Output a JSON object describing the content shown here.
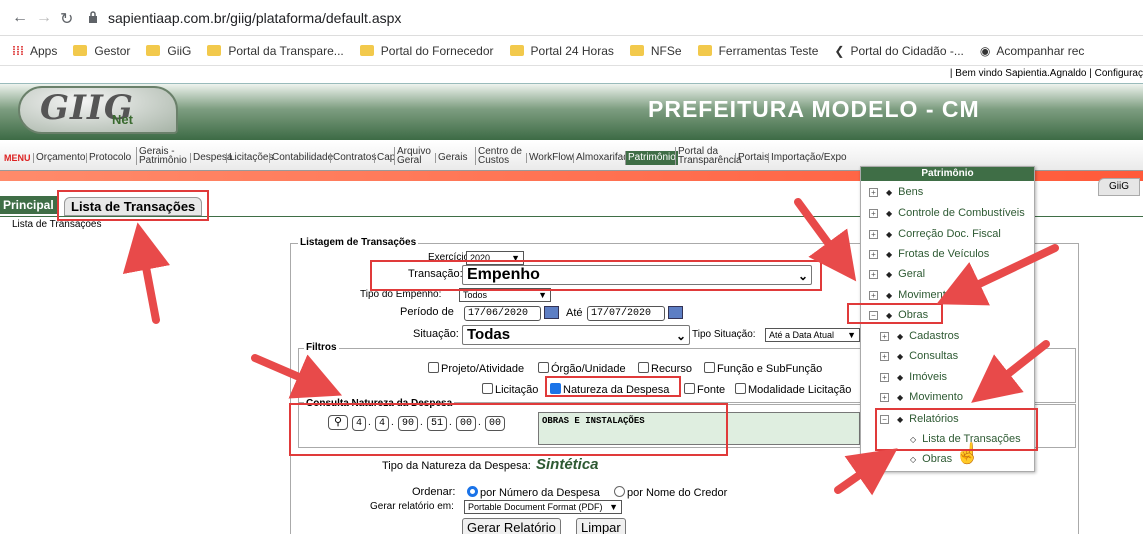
{
  "browser": {
    "url": "sapientiaap.com.br/giig/plataforma/default.aspx",
    "bookmarks": [
      "Apps",
      "Gestor",
      "GiiG",
      "Portal da Transpare...",
      "Portal do Fornecedor",
      "Portal 24 Horas",
      "NFSe",
      "Ferramentas Teste",
      "Portal do Cidadão -...",
      "Acompanhar rec"
    ]
  },
  "header": {
    "welcome": "| Bem vindo Sapientia.Agnaldo | Configuraç",
    "logo_text": "GIIG",
    "logo_net": "Net",
    "title": "PREFEITURA MODELO - CM"
  },
  "menu": {
    "label": "MENU",
    "items": [
      "Orçamento",
      "Protocolo",
      "Gerais -",
      "Patrimônio",
      "Despesa",
      "Licitações",
      "Contabilidade",
      "Contratos",
      "Cap",
      "Arquivo",
      "Geral",
      "Gerais",
      "Centro de",
      "Custos",
      "WorkFlow",
      "Almoxarifado",
      "Patrimônio",
      "Portal da",
      "Transparência",
      "Portais",
      "Importação/Expo"
    ]
  },
  "tabs": {
    "principal": "Principal",
    "lista": "Lista de Transações",
    "giig": "GiiG"
  },
  "breadcrumb": "Lista de Transações",
  "form": {
    "legend": "Listagem de Transações",
    "exercicio_label": "Exercício:",
    "exercicio": "2020",
    "transacao_label": "Transação:",
    "transacao": "Empenho",
    "tipo_empenho_label": "Tipo do Empenho:",
    "tipo_empenho": "Todos",
    "periodo_label": "Período de",
    "data_inicio": "17/06/2020",
    "ate_label": "Até",
    "data_fim": "17/07/2020",
    "situacao_label": "Situação:",
    "situacao": "Todas",
    "tipo_situacao_label": "Tipo Situação:",
    "tipo_situacao": "Até a Data Atual",
    "filtros_legend": "Filtros",
    "filtros_row1": [
      "Projeto/Atividade",
      "Órgão/Unidade",
      "Recurso",
      "Função e SubFunção"
    ],
    "filtros_row2": [
      "Licitação",
      "Natureza da Despesa",
      "Fonte",
      "Modalidade Licitação"
    ],
    "consulta_legend": "Consulta Natureza da Despesa",
    "nat_segments": [
      "4",
      "4",
      "90",
      "51",
      "00",
      "00"
    ],
    "nat_desc": "OBRAS E INSTALAÇÕES",
    "tipo_nat_label": "Tipo da Natureza da Despesa:",
    "tipo_nat": "Sintética",
    "ordenar_label": "Ordenar:",
    "ordenar_opt1": "por Número da Despesa",
    "ordenar_opt2": "por Nome do Credor",
    "gerar_em_label": "Gerar relatório em:",
    "gerar_em": "Portable Document Format (PDF)",
    "gerar_btn": "Gerar Relatório",
    "limpar_btn": "Limpar"
  },
  "dropdown": {
    "title": "Patrimônio",
    "items": [
      "Bens",
      "Controle de Combustíveis",
      "Correção Doc. Fiscal",
      "Frotas de Veículos",
      "Geral",
      "Movimento",
      "Obras"
    ],
    "obras_children": [
      "Cadastros",
      "Consultas",
      "Imóveis",
      "Movimento",
      "Relatórios"
    ],
    "relatorios_children": [
      "Lista de Transações",
      "Obras"
    ]
  },
  "colors": {
    "green": "#3f6e46",
    "highlight": "#e03a3a",
    "accent": "#1a73e8"
  }
}
